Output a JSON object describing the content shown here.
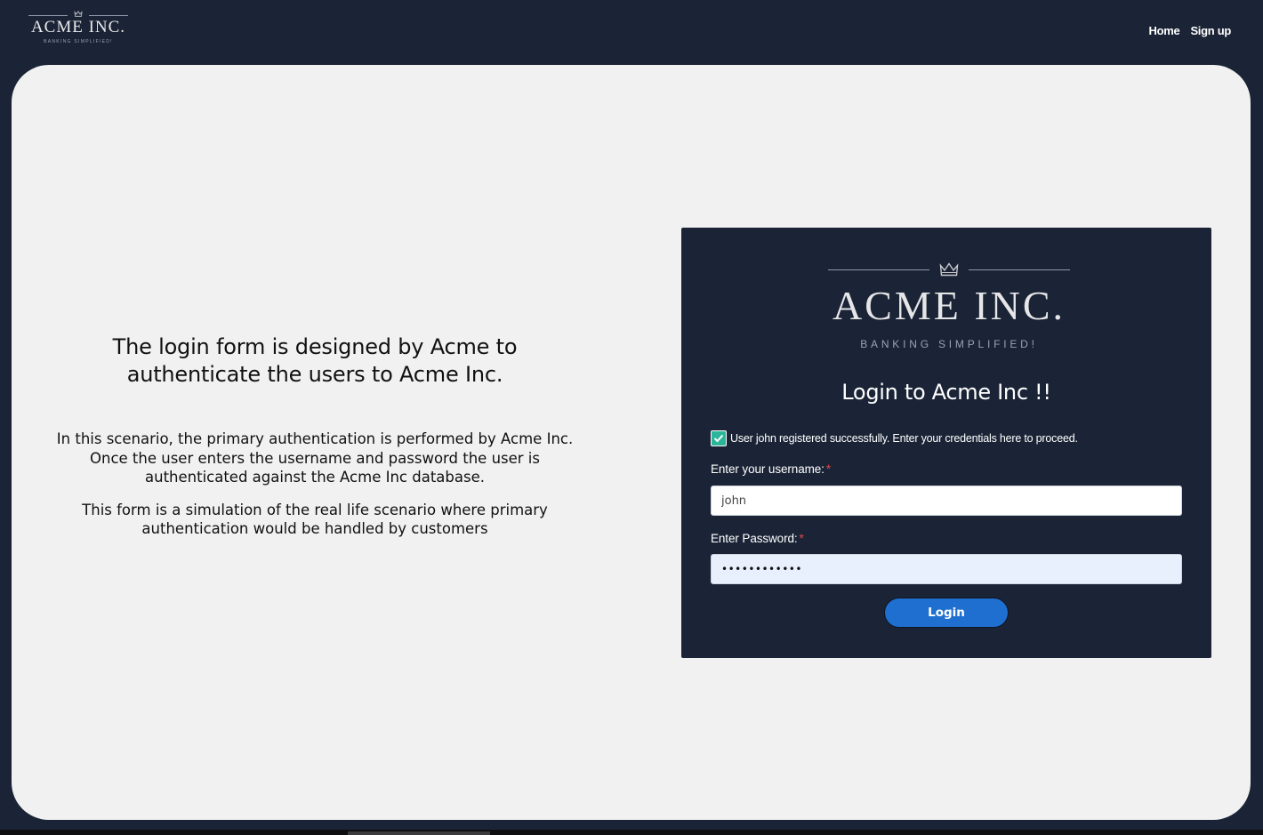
{
  "header": {
    "brand_name": "ACME INC.",
    "brand_tagline": "BANKING SIMPLIFIED!",
    "nav": {
      "home": "Home",
      "signup": "Sign up"
    }
  },
  "intro": {
    "heading": "The login form is designed by Acme to authenticate the users to Acme Inc.",
    "paragraph1": "In this scenario, the primary authentication is performed by Acme Inc. Once the user enters the username and password the user is authenticated against the Acme Inc database.",
    "paragraph2": "This form is a simulation of the real life scenario where primary authentication would be handled by customers"
  },
  "login_card": {
    "logo_name": "ACME INC.",
    "logo_tagline": "BANKING SIMPLIFIED!",
    "title": "Login to Acme Inc !!",
    "alert_message": "User john registered successfully. Enter your credentials here to proceed.",
    "username_label": "Enter your username:",
    "username_value": "john",
    "password_label": "Enter Password:",
    "password_value": "password1234",
    "required_marker": "*",
    "login_button": "Login"
  },
  "colors": {
    "background": "#1b2436",
    "panel": "#f1f1f1",
    "primary_button": "#1f6fd1",
    "success_check": "#2bb59a",
    "required": "#e0474c"
  },
  "icons": {
    "brand": "crown-icon",
    "alert": "checkmark-icon"
  }
}
